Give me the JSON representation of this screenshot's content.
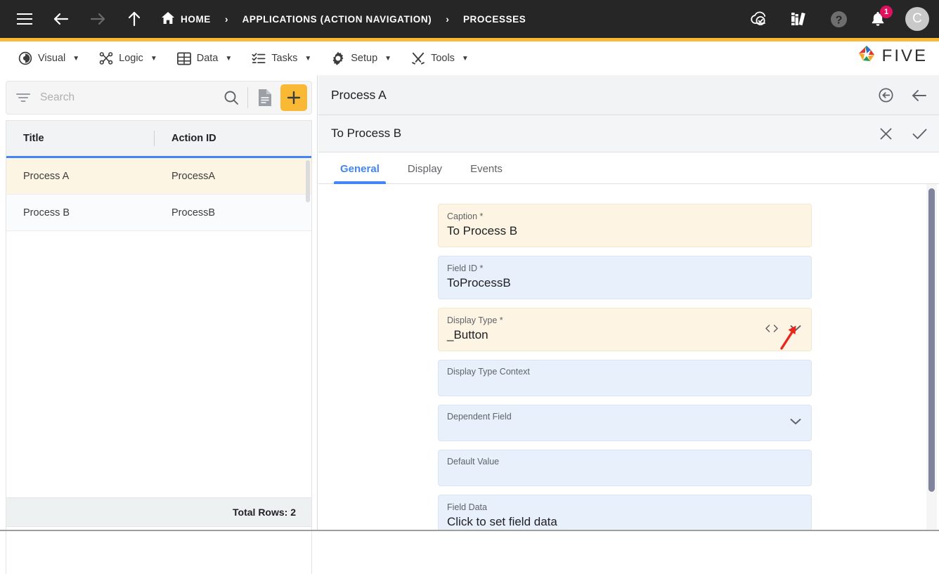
{
  "topbar": {
    "nav_icons": [
      {
        "name": "hamburger-menu-icon",
        "label": "Menu"
      },
      {
        "name": "back-arrow-icon",
        "label": "Back"
      },
      {
        "name": "forward-arrow-icon",
        "label": "Forward"
      },
      {
        "name": "up-arrow-icon",
        "label": "Up"
      }
    ],
    "breadcrumb": [
      {
        "label": "HOME",
        "icon": "home-icon"
      },
      {
        "label": "APPLICATIONS (ACTION NAVIGATION)",
        "icon": ""
      },
      {
        "label": "PROCESSES",
        "icon": ""
      }
    ],
    "separator": "›",
    "right_icons": [
      {
        "name": "cloud-check-icon",
        "label": "Deploy"
      },
      {
        "name": "library-books-icon",
        "label": "Documentation"
      },
      {
        "name": "help-circle-icon",
        "label": "Help"
      },
      {
        "name": "notification-bell-icon",
        "label": "Notifications",
        "badge": "1"
      }
    ],
    "avatar_initial": "C",
    "background": "#262626",
    "accent": "#f9b934"
  },
  "menubar": {
    "items": [
      {
        "label": "Visual",
        "icon": "eye-icon",
        "caret": "▼"
      },
      {
        "label": "Logic",
        "icon": "logic-nodes-icon",
        "caret": "▼"
      },
      {
        "label": "Data",
        "icon": "table-grid-icon",
        "caret": "▼"
      },
      {
        "label": "Tasks",
        "icon": "checklist-icon",
        "caret": "▼"
      },
      {
        "label": "Setup",
        "icon": "gear-icon",
        "caret": "▼"
      },
      {
        "label": "Tools",
        "icon": "tools-crossed-icon",
        "caret": "▼"
      }
    ],
    "logo_text": "FIVE"
  },
  "left_panel": {
    "search": {
      "placeholder": "Search",
      "value": "",
      "filter_icon": "filter-list-icon",
      "search_icon": "search-icon",
      "report_icon": "document-report-icon",
      "add_label": "+",
      "add_color": "#f9b934"
    },
    "columns": [
      "Title",
      "Action ID"
    ],
    "rows": [
      {
        "title": "Process A",
        "action_id": "ProcessA",
        "selected": true
      },
      {
        "title": "Process B",
        "action_id": "ProcessB",
        "selected": false
      }
    ],
    "footer": "Total Rows: 2"
  },
  "right_panel": {
    "header": {
      "title": "Process A",
      "actions": [
        {
          "name": "undo-circle-icon",
          "label": "Revert"
        },
        {
          "name": "back-arrow-icon",
          "label": "Back"
        }
      ]
    },
    "subheader": {
      "title": "To Process B",
      "actions": [
        {
          "name": "close-icon",
          "label": "Cancel"
        },
        {
          "name": "check-icon",
          "label": "Confirm"
        }
      ]
    },
    "tabs": [
      {
        "label": "General",
        "active": true
      },
      {
        "label": "Display",
        "active": false
      },
      {
        "label": "Events",
        "active": false
      }
    ],
    "fields": [
      {
        "id": "caption",
        "label": "Caption *",
        "value": "To Process B",
        "style": "cream",
        "icons": []
      },
      {
        "id": "field-id",
        "label": "Field ID *",
        "value": "ToProcessB",
        "style": "blue",
        "icons": []
      },
      {
        "id": "display-type",
        "label": "Display Type *",
        "value": "_Button",
        "style": "cream",
        "icons": [
          "code-brackets-icon",
          "chevron-down-icon"
        ]
      },
      {
        "id": "display-type-context",
        "label": "Display Type Context",
        "value": "",
        "style": "blue",
        "icons": []
      },
      {
        "id": "dependent-field",
        "label": "Dependent Field",
        "value": "",
        "style": "blue",
        "icons": [
          "chevron-down-icon"
        ]
      },
      {
        "id": "default-value",
        "label": "Default Value",
        "value": "",
        "style": "blue",
        "icons": []
      },
      {
        "id": "field-data",
        "label": "Field Data",
        "value": "Click to set field data",
        "style": "blue",
        "icons": []
      }
    ],
    "annotation": {
      "name": "red-pointer-arrow",
      "color": "#e8261c",
      "target": "chevron-down-icon"
    }
  }
}
